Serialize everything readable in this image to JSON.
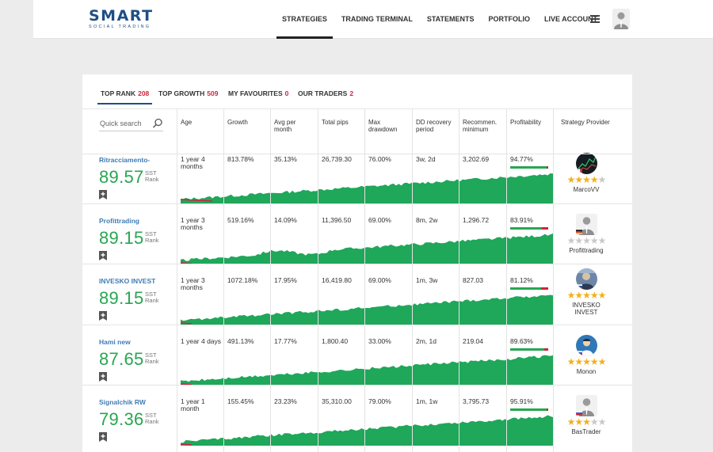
{
  "brand": {
    "name": "SMART",
    "tagline": "SOCIAL TRADING"
  },
  "nav": [
    "STRATEGIES",
    "TRADING TERMINAL",
    "STATEMENTS",
    "PORTFOLIO",
    "LIVE ACCOUNT"
  ],
  "tabs": [
    {
      "label": "TOP RANK",
      "count": "208"
    },
    {
      "label": "TOP GROWTH",
      "count": "509"
    },
    {
      "label": "MY FAVOURITES",
      "count": "0"
    },
    {
      "label": "OUR TRADERS",
      "count": "2"
    }
  ],
  "search": {
    "placeholder": "Quick search"
  },
  "columns": [
    [
      "Age"
    ],
    [
      "Growth"
    ],
    [
      "Avg per",
      "month"
    ],
    [
      "Total pips"
    ],
    [
      "Max",
      "drawdown"
    ],
    [
      "DD recovery",
      "period"
    ],
    [
      "Recommen.",
      "minimum"
    ],
    [
      "Profitability"
    ],
    [
      "Strategy Provider"
    ]
  ],
  "rank_suffix": [
    "SST",
    "Rank"
  ],
  "strategies": [
    {
      "name": "Ritracciamento-",
      "score": "89.57",
      "age": [
        "1 year 4",
        "months"
      ],
      "growth": "813.78%",
      "avg": "35.13%",
      "pips": "26,739.30",
      "drawdown": "76.00%",
      "recovery": "3w, 2d",
      "minimum": "3,202.69",
      "profitability": "94.77%",
      "profit_fraction": 0.9477,
      "provider": [
        "MarcoVV"
      ],
      "stars": 4,
      "flag": "italy",
      "picture": "dark-chart-avatar"
    },
    {
      "name": "Profittrading",
      "score": "89.15",
      "age": [
        "1 year 3",
        "months"
      ],
      "growth": "519.16%",
      "avg": "14.09%",
      "pips": "11,396.50",
      "drawdown": "69.00%",
      "recovery": "8m, 2w",
      "minimum": "1,296.72",
      "profitability": "83.91%",
      "profit_fraction": 0.8391,
      "provider": [
        "Profittrading"
      ],
      "stars": 0,
      "flag": "germany",
      "picture": "default-avatar"
    },
    {
      "name": "INVESKO INVEST",
      "score": "89.15",
      "age": [
        "1 year 3",
        "months"
      ],
      "growth": "1072.18%",
      "avg": "17.95%",
      "pips": "16,419.80",
      "drawdown": "69.00%",
      "recovery": "1m, 3w",
      "minimum": "827.03",
      "profitability": "81.12%",
      "profit_fraction": 0.8112,
      "provider": [
        "INVESKO",
        "INVEST"
      ],
      "stars": 5,
      "flag": "russia",
      "picture": "photo-avatar"
    },
    {
      "name": "Hami new",
      "score": "87.65",
      "age": [
        "1 year 4 days"
      ],
      "growth": "491.13%",
      "avg": "17.77%",
      "pips": "1,800.40",
      "drawdown": "33.00%",
      "recovery": "2m, 1d",
      "minimum": "219.04",
      "profitability": "89.63%",
      "profit_fraction": 0.8963,
      "provider": [
        "Monon"
      ],
      "stars": 5,
      "flag": "russia",
      "picture": "blue-person-avatar"
    },
    {
      "name": "Signalchik RW",
      "score": "79.36",
      "age": [
        "1 year 1",
        "month"
      ],
      "growth": "155.45%",
      "avg": "23.23%",
      "pips": "35,310.00",
      "drawdown": "79.00%",
      "recovery": "1m, 1w",
      "minimum": "3,795.73",
      "profitability": "95.91%",
      "profit_fraction": 0.9591,
      "provider": [
        "BasTrader"
      ],
      "stars": 3,
      "flag": "russia",
      "picture": "default-avatar"
    }
  ],
  "colors": {
    "brand": "#1e4f86",
    "link": "#3f7cb5",
    "score": "#27a651",
    "chart_fill": "#1fa75a",
    "negative": "#d0243f",
    "star": "#f3b01c"
  },
  "icons": [
    "search-icon",
    "bookmark-add-icon",
    "hamburger-menu-icon",
    "user-avatar-icon",
    "star-icon"
  ]
}
